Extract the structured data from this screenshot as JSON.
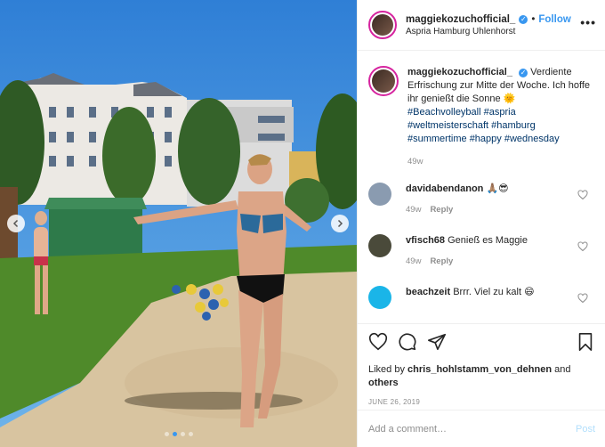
{
  "post": {
    "username": "maggiekozuchofficial_",
    "separator": "•",
    "follow_label": "Follow",
    "location": "Aspria Hamburg Uhlenhorst",
    "more_icon": "more-options-icon",
    "more_label": "•••"
  },
  "caption": {
    "username": "maggiekozuchofficial_",
    "text": "Verdiente Erfrischung zur Mitte der Woche. Ich hoffe ihr genießt die Sonne",
    "emoji": "🌞",
    "hashtags": [
      "#Beachvolleyball",
      "#aspria",
      "#weltmeisterschaft",
      "#hamburg",
      "#summertime",
      "#happy",
      "#wednesday"
    ],
    "time": "49w"
  },
  "comments": [
    {
      "username": "davidabendanon",
      "text": "🙏🏽😎",
      "time": "49w",
      "reply": "Reply",
      "avatar_color": "#8a9bb0"
    },
    {
      "username": "vfisch68",
      "text": "Genieß es Maggie",
      "time": "49w",
      "reply": "Reply",
      "avatar_color": "#4a4a3a"
    },
    {
      "username": "beachzeit",
      "text": "Brrr. Viel zu kalt 😄",
      "time": "",
      "reply": "",
      "avatar_color": "#1ab5e8"
    }
  ],
  "actions": {
    "icons": [
      "heart-icon",
      "comment-icon",
      "share-icon",
      "bookmark-icon"
    ]
  },
  "likes": {
    "prefix": "Liked by",
    "user": "chris_hohlstamm_von_dehnen",
    "and": "and",
    "others": "others"
  },
  "date": "JUNE 26, 2019",
  "add_comment": {
    "placeholder": "Add a comment…",
    "post_label": "Post"
  },
  "carousel": {
    "slides_count": 4,
    "active_index": 1
  },
  "colors": {
    "accent": "#3897f0",
    "muted": "#8e8e8e",
    "hashtag": "#003569"
  }
}
